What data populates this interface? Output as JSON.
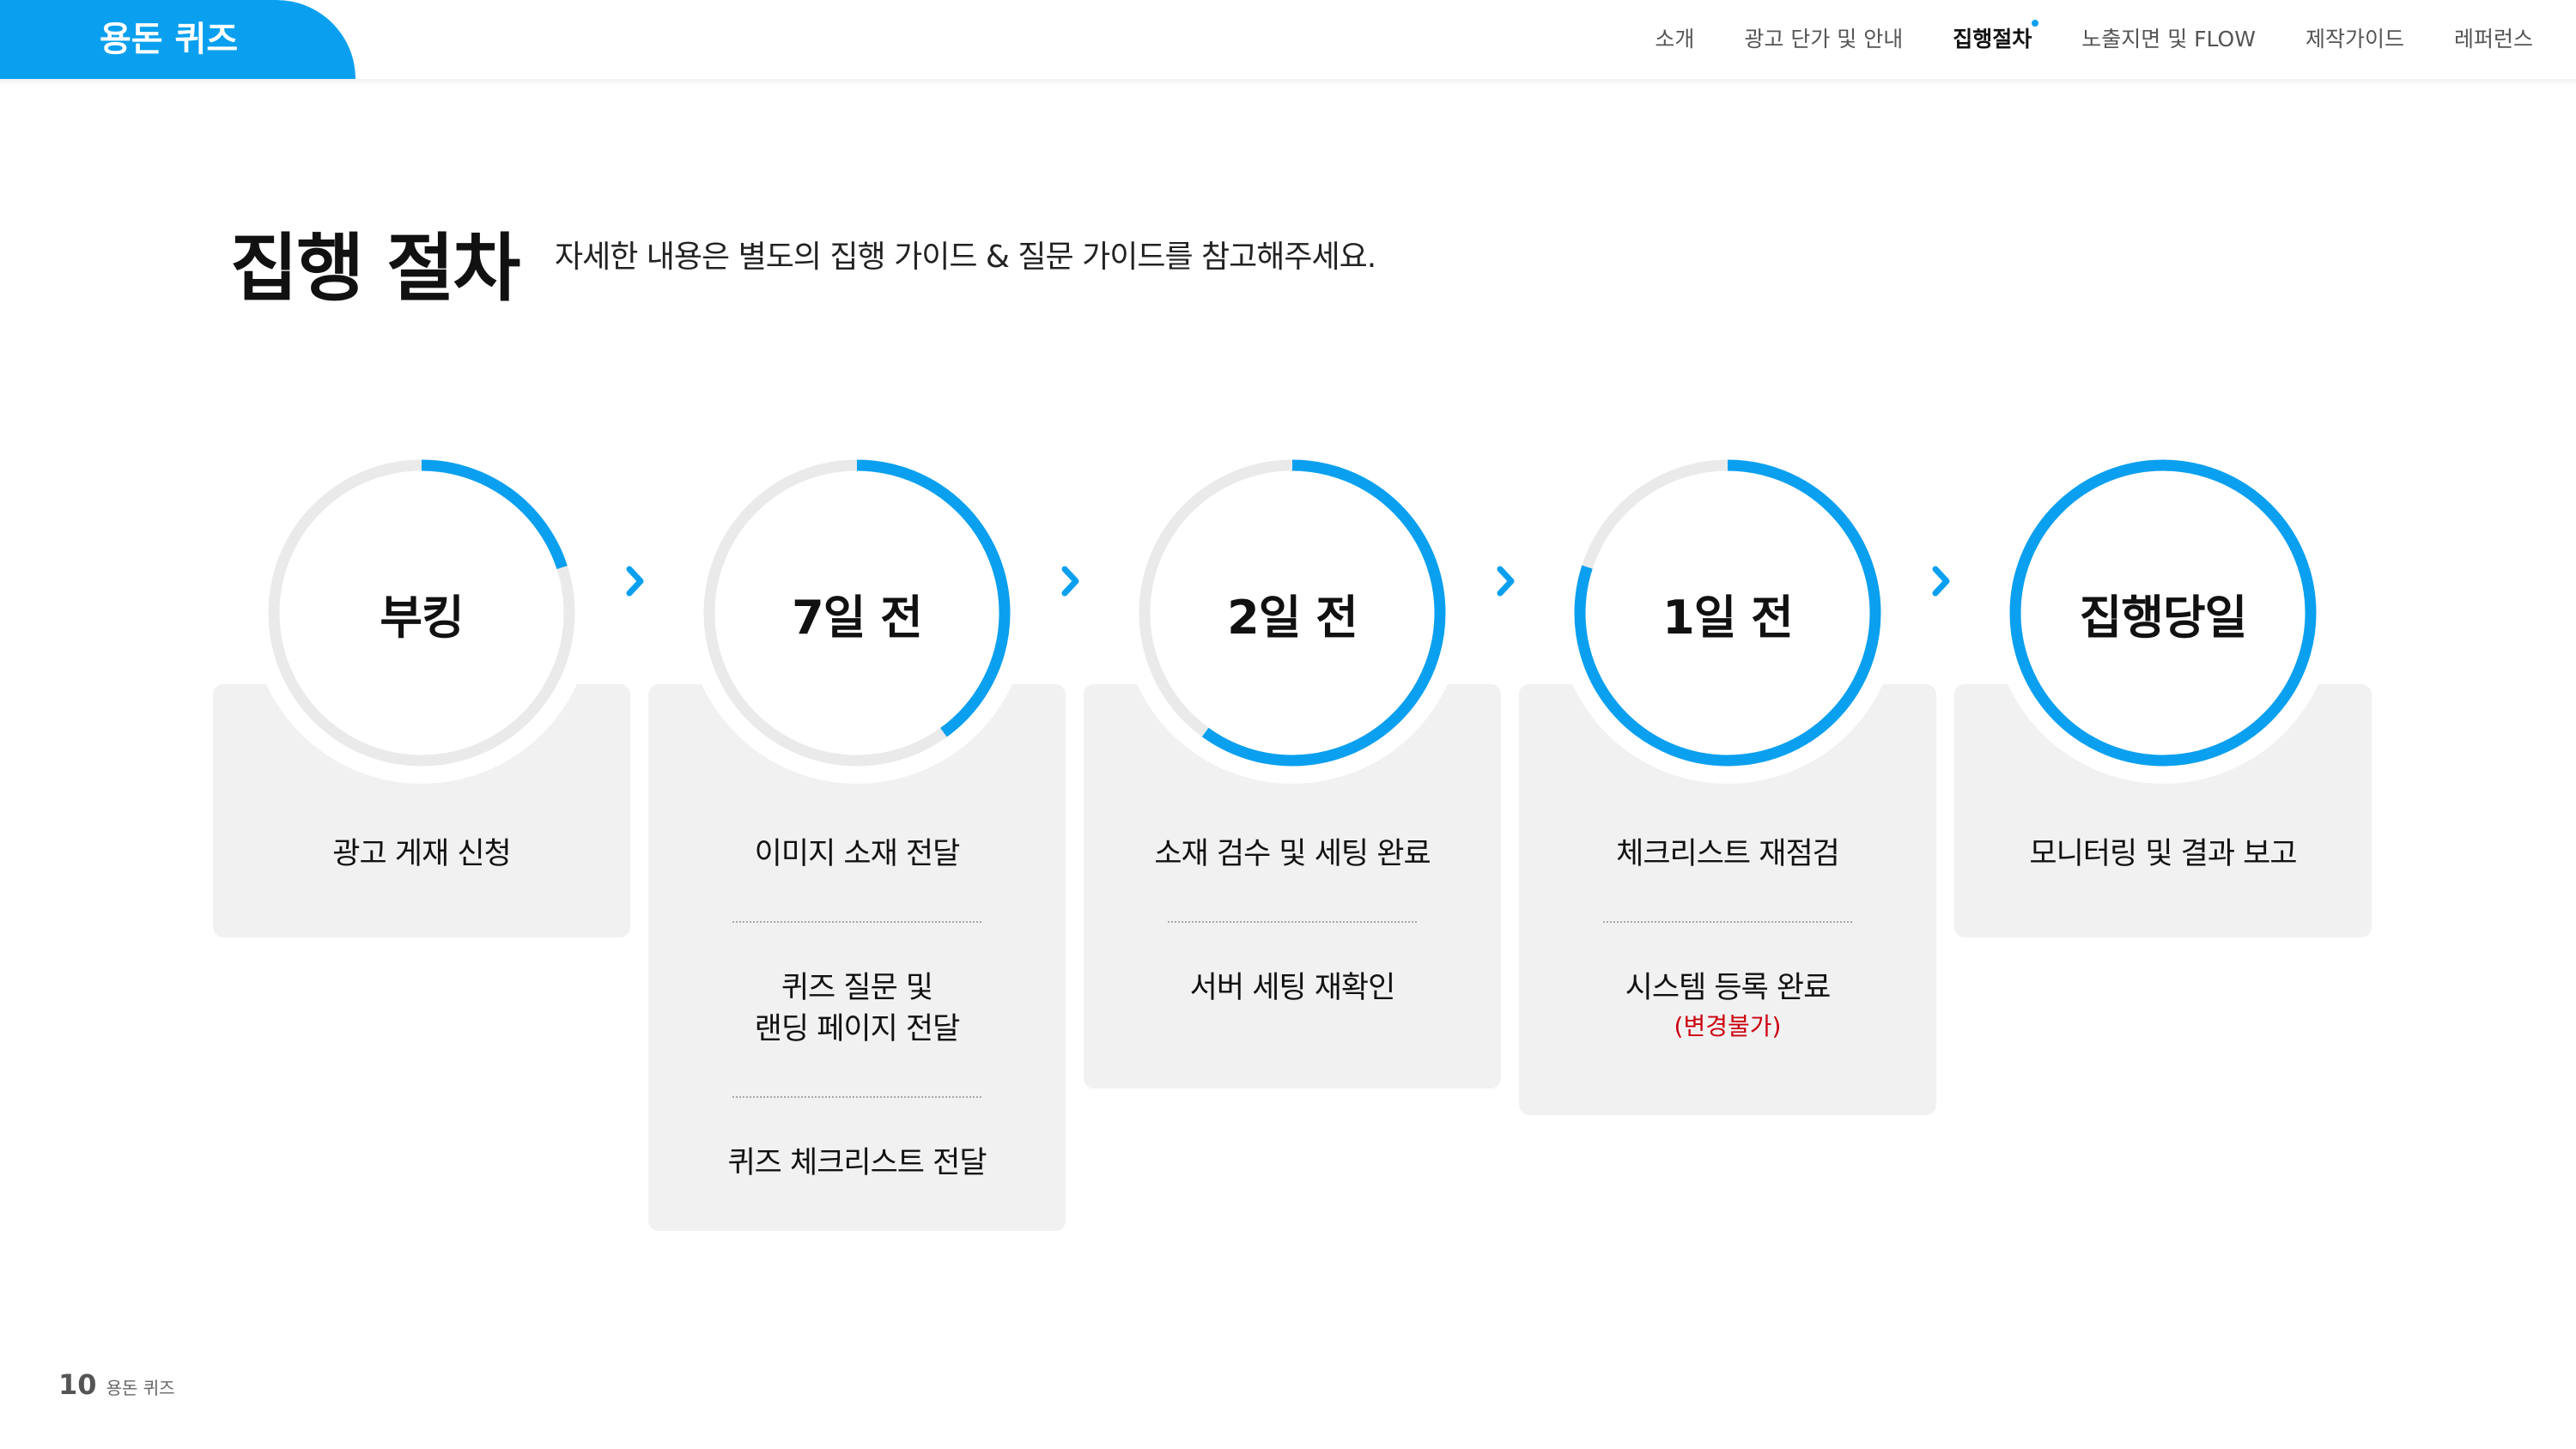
{
  "header": {
    "brand": "용돈 퀴즈",
    "nav": [
      {
        "label": "소개",
        "active": false
      },
      {
        "label": "광고 단가 및 안내",
        "active": false
      },
      {
        "label": "집행절차",
        "active": true
      },
      {
        "label": "노출지면 및 FLOW",
        "active": false
      },
      {
        "label": "제작가이드",
        "active": false
      },
      {
        "label": "레퍼런스",
        "active": false
      }
    ]
  },
  "title": "집행 절차",
  "subtitle": "자세한 내용은 별도의 집행 가이드 & 질문 가이드를 참고해주세요.",
  "colors": {
    "accent": "#0aa0ef",
    "ring_track": "#eaeaea",
    "card_bg": "#f1f1f1",
    "note_red": "#cc0010"
  },
  "steps": [
    {
      "label": "부킹",
      "progress": 0.2,
      "items": [
        {
          "text": "광고 게재 신청"
        }
      ]
    },
    {
      "label": "7일 전",
      "progress": 0.4,
      "items": [
        {
          "text": "이미지 소재 전달"
        },
        {
          "text": "퀴즈 질문 및\n랜딩 페이지 전달"
        },
        {
          "text": "퀴즈 체크리스트 전달"
        }
      ]
    },
    {
      "label": "2일 전",
      "progress": 0.6,
      "items": [
        {
          "text": "소재 검수 및 세팅 완료"
        },
        {
          "text": "서버 세팅 재확인"
        }
      ]
    },
    {
      "label": "1일 전",
      "progress": 0.8,
      "items": [
        {
          "text": "체크리스트 재점검"
        },
        {
          "text": "시스템 등록 완료",
          "note": "(변경불가)"
        }
      ]
    },
    {
      "label": "집행당일",
      "progress": 1.0,
      "items": [
        {
          "text": "모니터링 및 결과 보고"
        }
      ]
    }
  ],
  "footer": {
    "page_number": "10",
    "brand": "용돈 퀴즈"
  }
}
